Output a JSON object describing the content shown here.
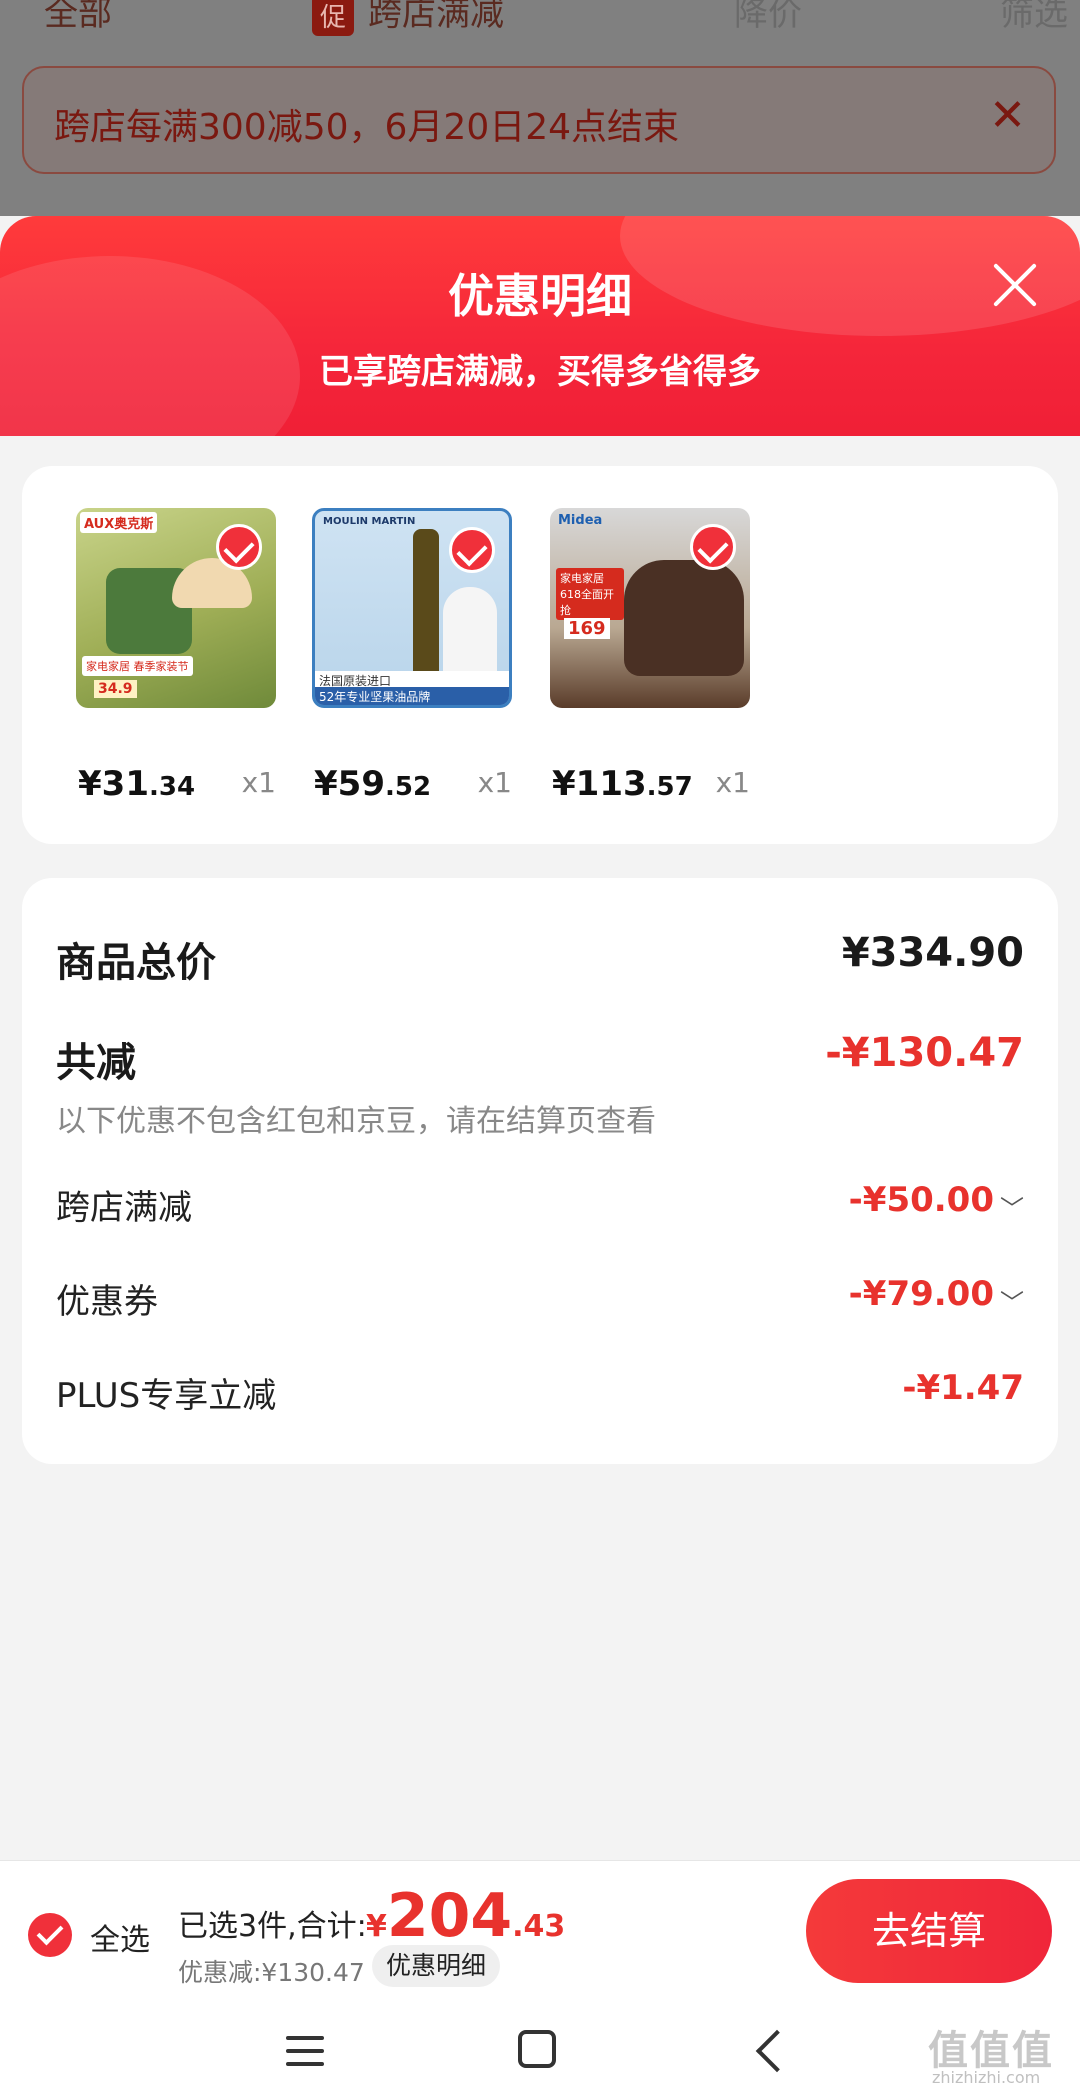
{
  "background_page": {
    "tabs": [
      "全部",
      "跨店满减",
      "降价",
      "筛选"
    ],
    "promo_badge": "促",
    "banner_text": "跨店每满300减50，6月20日24点结束",
    "banner_close": "✕"
  },
  "sheet": {
    "title": "优惠明细",
    "subtitle": "已享跨店满减，买得多省得多"
  },
  "products": [
    {
      "brand": "AUX奥克斯",
      "price_int": "¥31",
      "price_dec": ".34",
      "qty": "x1",
      "img_label": "家电家居 春季家装节",
      "img_price": "34.9"
    },
    {
      "brand": "MOULIN MARTIN",
      "price_int": "¥59",
      "price_dec": ".52",
      "qty": "x1",
      "img_label": "法国原装进口",
      "img_footer": "52年专业坚果油品牌"
    },
    {
      "brand": "Midea",
      "price_int": "¥113",
      "price_dec": ".57",
      "qty": "x1",
      "img_label": "家电家居 618全面开抢",
      "img_price": "169"
    }
  ],
  "summary": {
    "total_label": "商品总价",
    "total_value": "¥334.90",
    "discount_label": "共减",
    "discount_value": "-¥130.47",
    "note": "以下优惠不包含红包和京豆，请在结算页查看",
    "items": [
      {
        "label": "跨店满减",
        "value": "-¥50.00",
        "expandable": true
      },
      {
        "label": "优惠券",
        "value": "-¥79.00",
        "expandable": true
      },
      {
        "label": "PLUS专享立减",
        "value": "-¥1.47",
        "expandable": false
      }
    ],
    "chevron": "﹀"
  },
  "bottom": {
    "select_all": "全选",
    "count_text": "已选3件,合计:",
    "total_currency": "¥",
    "total_int": "204",
    "total_dec": ".43",
    "discount_text": "优惠减:¥130.47",
    "detail_chip": "优惠明细",
    "checkout": "去结算"
  },
  "watermark": {
    "text": "值值值",
    "url": "zhizhizhi.com"
  },
  "colors": {
    "accent": "#e8322d",
    "header": "#f5263a"
  }
}
